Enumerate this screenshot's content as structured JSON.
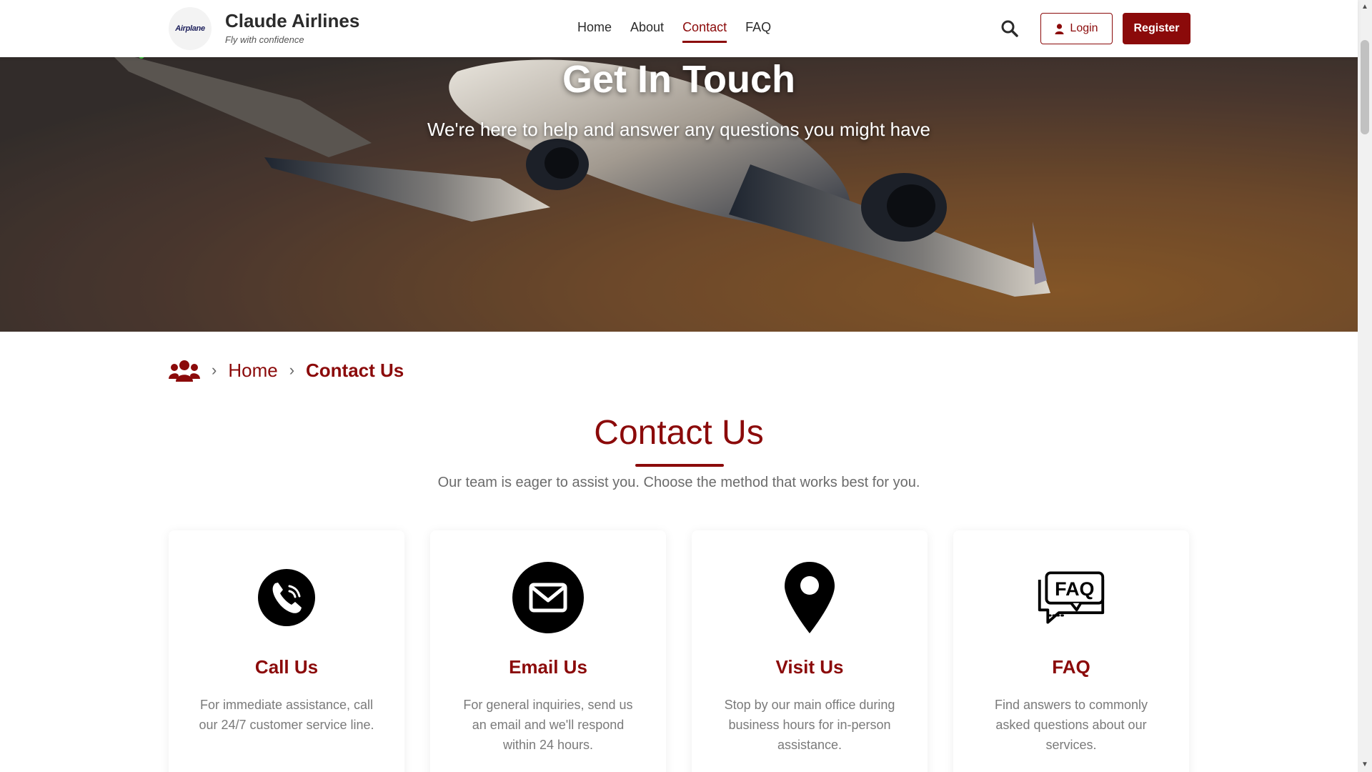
{
  "header": {
    "logo_text": "Airplane",
    "brand_name": "Claude Airlines",
    "tagline": "Fly with confidence",
    "nav": [
      {
        "label": "Home",
        "active": false
      },
      {
        "label": "About",
        "active": false
      },
      {
        "label": "Contact",
        "active": true
      },
      {
        "label": "FAQ",
        "active": false
      }
    ],
    "search_icon": "search-icon",
    "login_label": "Login",
    "register_label": "Register"
  },
  "hero": {
    "title": "Get In Touch",
    "subtitle": "We're here to help and answer any questions you might have"
  },
  "breadcrumb": {
    "icon": "users-icon",
    "home": "Home",
    "current": "Contact Us"
  },
  "section": {
    "title": "Contact Us",
    "subtitle": "Our team is eager to assist you. Choose the method that works best for you."
  },
  "cards": [
    {
      "icon": "phone-icon",
      "title": "Call Us",
      "desc": "For immediate assistance, call our 24/7 customer service line."
    },
    {
      "icon": "email-icon",
      "title": "Email Us",
      "desc": "For general inquiries, send us an email and we'll respond within 24 hours."
    },
    {
      "icon": "location-pin-icon",
      "title": "Visit Us",
      "desc": "Stop by our main office during business hours for in-person assistance."
    },
    {
      "icon": "faq-icon",
      "title": "FAQ",
      "desc": "Find answers to commonly asked questions about our services."
    }
  ],
  "colors": {
    "accent": "#8b0a0a",
    "text_dark": "#2b2b2b",
    "text_muted": "#7a7a7a"
  }
}
